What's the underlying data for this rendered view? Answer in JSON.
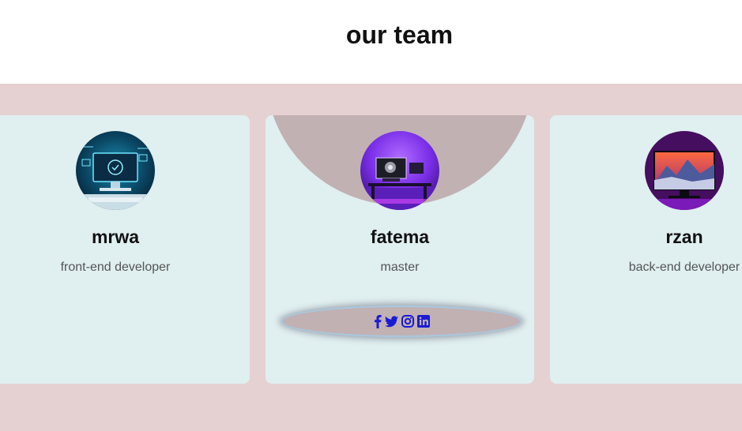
{
  "page": {
    "title": "our team"
  },
  "team": {
    "members": [
      {
        "name": "mrwa",
        "role": "front-end developer",
        "avatar_icon": "cyber-computer-avatar"
      },
      {
        "name": "fatema",
        "role": "master",
        "avatar_icon": "purple-gaming-setup-avatar",
        "social": [
          {
            "icon": "facebook-icon"
          },
          {
            "icon": "twitter-icon"
          },
          {
            "icon": "instagram-icon"
          },
          {
            "icon": "linkedin-icon"
          }
        ]
      },
      {
        "name": "rzan",
        "role": "back-end developer",
        "avatar_icon": "mountain-monitor-avatar"
      }
    ]
  },
  "colors": {
    "section_background": "#e5d1d1",
    "card_background": "#e0eff0",
    "accent_arc": "#c1b1b3",
    "social_icon": "#1a1ad6"
  }
}
